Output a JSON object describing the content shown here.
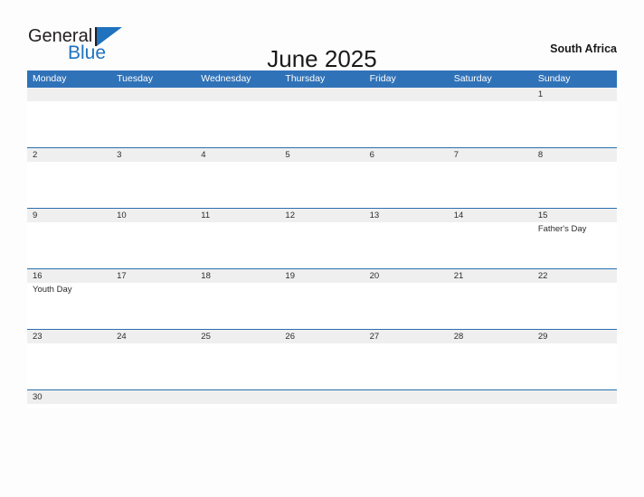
{
  "brand": {
    "name_part1": "General",
    "name_part2": "Blue",
    "flag_icon": "triangle-flag-icon",
    "color_dark": "#231f20",
    "color_blue": "#1f72bd"
  },
  "header": {
    "title": "June 2025",
    "region": "South Africa"
  },
  "colors": {
    "header_blue": "#3072b8",
    "divider_blue": "#2a6fae",
    "daynum_band": "#efefef",
    "page_background": "#fdfdfd",
    "text": "#2b2b2b"
  },
  "calendar": {
    "month": "June",
    "year": "2025",
    "weekday_headers": [
      "Monday",
      "Tuesday",
      "Wednesday",
      "Thursday",
      "Friday",
      "Saturday",
      "Sunday"
    ],
    "weeks": [
      {
        "days": [
          {
            "number": "",
            "events": []
          },
          {
            "number": "",
            "events": []
          },
          {
            "number": "",
            "events": []
          },
          {
            "number": "",
            "events": []
          },
          {
            "number": "",
            "events": []
          },
          {
            "number": "",
            "events": []
          },
          {
            "number": "1",
            "events": []
          }
        ]
      },
      {
        "days": [
          {
            "number": "2",
            "events": []
          },
          {
            "number": "3",
            "events": []
          },
          {
            "number": "4",
            "events": []
          },
          {
            "number": "5",
            "events": []
          },
          {
            "number": "6",
            "events": []
          },
          {
            "number": "7",
            "events": []
          },
          {
            "number": "8",
            "events": []
          }
        ]
      },
      {
        "days": [
          {
            "number": "9",
            "events": []
          },
          {
            "number": "10",
            "events": []
          },
          {
            "number": "11",
            "events": []
          },
          {
            "number": "12",
            "events": []
          },
          {
            "number": "13",
            "events": []
          },
          {
            "number": "14",
            "events": []
          },
          {
            "number": "15",
            "events": [
              "Father's Day"
            ]
          }
        ]
      },
      {
        "days": [
          {
            "number": "16",
            "events": [
              "Youth Day"
            ]
          },
          {
            "number": "17",
            "events": []
          },
          {
            "number": "18",
            "events": []
          },
          {
            "number": "19",
            "events": []
          },
          {
            "number": "20",
            "events": []
          },
          {
            "number": "21",
            "events": []
          },
          {
            "number": "22",
            "events": []
          }
        ]
      },
      {
        "days": [
          {
            "number": "23",
            "events": []
          },
          {
            "number": "24",
            "events": []
          },
          {
            "number": "25",
            "events": []
          },
          {
            "number": "26",
            "events": []
          },
          {
            "number": "27",
            "events": []
          },
          {
            "number": "28",
            "events": []
          },
          {
            "number": "29",
            "events": []
          }
        ]
      },
      {
        "short": true,
        "days": [
          {
            "number": "30",
            "events": []
          },
          {
            "number": "",
            "events": []
          },
          {
            "number": "",
            "events": []
          },
          {
            "number": "",
            "events": []
          },
          {
            "number": "",
            "events": []
          },
          {
            "number": "",
            "events": []
          },
          {
            "number": "",
            "events": []
          }
        ]
      }
    ]
  }
}
